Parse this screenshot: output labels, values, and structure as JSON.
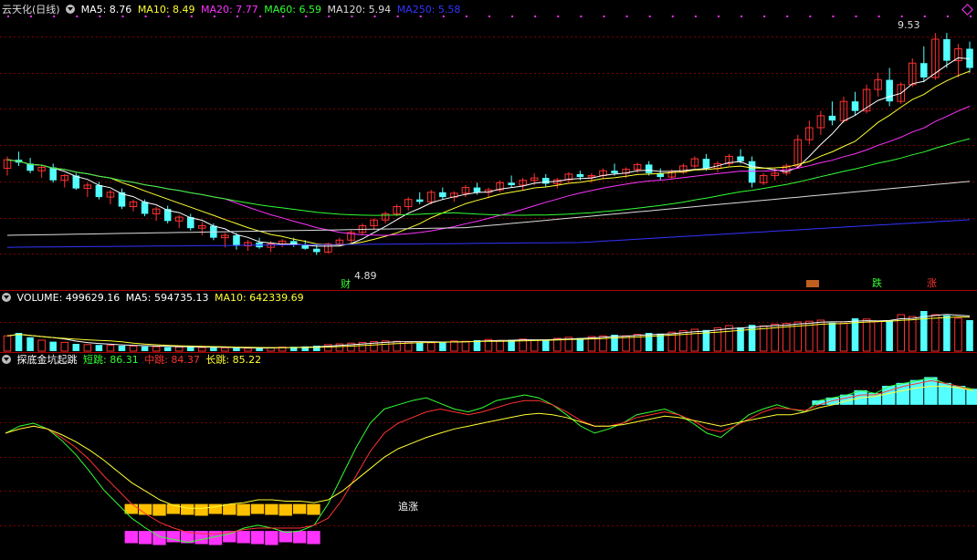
{
  "header": {
    "title": "云天化(日线)",
    "ma": [
      {
        "label": "MA5: 8.76",
        "color": "#ffffff"
      },
      {
        "label": "MA10: 8.49",
        "color": "#ffff33"
      },
      {
        "label": "MA20: 7.77",
        "color": "#ff33ff"
      },
      {
        "label": "MA60: 6.59",
        "color": "#33ff33"
      },
      {
        "label": "MA120: 5.94",
        "color": "#dddddd"
      },
      {
        "label": "MA250: 5.58",
        "color": "#3333ff"
      }
    ]
  },
  "volume_legend": {
    "title": "VOLUME: 499629.16",
    "ma5": "MA5: 594735.13",
    "ma10": "MA10: 642339.69"
  },
  "indicator_legend": {
    "title": "探底金坑起跳",
    "short": "短跳: 86.31",
    "mid": "中跳: 84.37",
    "long": "长跳: 85.22"
  },
  "annotations": {
    "high": "9.53",
    "low": "4.89",
    "cai": "财",
    "die": "跌",
    "zhang": "涨",
    "zhuizhang": "追涨"
  },
  "colors": {
    "up": "#ff3232",
    "down": "#54ffff",
    "ma5": "#ffffff",
    "ma10": "#ffff33",
    "ma20": "#ff33ff",
    "ma60": "#33ff33",
    "ma120": "#dddddd",
    "ma250": "#3333ff",
    "gold": "#ffc000",
    "pink": "#ff33ff"
  },
  "chart_data": [
    {
      "type": "candlestick",
      "title": "云天化(日线)",
      "ylim": [
        4.5,
        9.8
      ],
      "high_label": 9.53,
      "low_label": 4.89,
      "ohlc": [
        [
          6.7,
          6.95,
          6.55,
          6.88
        ],
        [
          6.88,
          7.05,
          6.75,
          6.82
        ],
        [
          6.8,
          6.92,
          6.6,
          6.65
        ],
        [
          6.65,
          6.78,
          6.5,
          6.72
        ],
        [
          6.72,
          6.8,
          6.4,
          6.45
        ],
        [
          6.45,
          6.58,
          6.3,
          6.55
        ],
        [
          6.55,
          6.6,
          6.25,
          6.28
        ],
        [
          6.28,
          6.4,
          6.1,
          6.35
        ],
        [
          6.35,
          6.42,
          6.05,
          6.1
        ],
        [
          6.1,
          6.25,
          5.95,
          6.2
        ],
        [
          6.2,
          6.28,
          5.85,
          5.9
        ],
        [
          5.9,
          6.05,
          5.8,
          6.0
        ],
        [
          6.0,
          6.05,
          5.7,
          5.75
        ],
        [
          5.75,
          5.9,
          5.6,
          5.85
        ],
        [
          5.85,
          5.92,
          5.55,
          5.6
        ],
        [
          5.6,
          5.72,
          5.45,
          5.68
        ],
        [
          5.68,
          5.75,
          5.4,
          5.45
        ],
        [
          5.45,
          5.58,
          5.3,
          5.5
        ],
        [
          5.5,
          5.55,
          5.2,
          5.25
        ],
        [
          5.25,
          5.35,
          5.05,
          5.3
        ],
        [
          5.3,
          5.35,
          5.0,
          5.08
        ],
        [
          5.08,
          5.2,
          4.98,
          5.15
        ],
        [
          5.15,
          5.25,
          5.02,
          5.05
        ],
        [
          5.05,
          5.18,
          4.95,
          5.12
        ],
        [
          5.12,
          5.22,
          5.05,
          5.18
        ],
        [
          5.18,
          5.25,
          5.06,
          5.1
        ],
        [
          5.1,
          5.2,
          5.0,
          5.02
        ],
        [
          5.02,
          5.1,
          4.89,
          4.95
        ],
        [
          4.95,
          5.15,
          4.92,
          5.12
        ],
        [
          5.12,
          5.25,
          5.08,
          5.2
        ],
        [
          5.2,
          5.4,
          5.15,
          5.36
        ],
        [
          5.36,
          5.55,
          5.3,
          5.5
        ],
        [
          5.5,
          5.65,
          5.42,
          5.62
        ],
        [
          5.62,
          5.8,
          5.55,
          5.75
        ],
        [
          5.75,
          5.95,
          5.7,
          5.9
        ],
        [
          5.9,
          6.1,
          5.82,
          6.05
        ],
        [
          6.05,
          6.2,
          5.95,
          6.0
        ],
        [
          6.0,
          6.25,
          5.95,
          6.2
        ],
        [
          6.2,
          6.3,
          6.05,
          6.1
        ],
        [
          6.1,
          6.22,
          6.0,
          6.18
        ],
        [
          6.18,
          6.35,
          6.1,
          6.3
        ],
        [
          6.3,
          6.4,
          6.15,
          6.2
        ],
        [
          6.2,
          6.3,
          6.08,
          6.25
        ],
        [
          6.25,
          6.45,
          6.2,
          6.4
        ],
        [
          6.4,
          6.55,
          6.3,
          6.35
        ],
        [
          6.35,
          6.5,
          6.25,
          6.45
        ],
        [
          6.45,
          6.6,
          6.35,
          6.5
        ],
        [
          6.5,
          6.58,
          6.3,
          6.38
        ],
        [
          6.38,
          6.5,
          6.28,
          6.46
        ],
        [
          6.46,
          6.62,
          6.4,
          6.58
        ],
        [
          6.58,
          6.65,
          6.45,
          6.52
        ],
        [
          6.52,
          6.6,
          6.4,
          6.55
        ],
        [
          6.55,
          6.7,
          6.48,
          6.65
        ],
        [
          6.65,
          6.8,
          6.55,
          6.6
        ],
        [
          6.6,
          6.72,
          6.5,
          6.68
        ],
        [
          6.68,
          6.82,
          6.6,
          6.78
        ],
        [
          6.78,
          6.85,
          6.55,
          6.6
        ],
        [
          6.6,
          6.7,
          6.45,
          6.52
        ],
        [
          6.52,
          6.68,
          6.48,
          6.62
        ],
        [
          6.62,
          6.8,
          6.58,
          6.75
        ],
        [
          6.75,
          6.95,
          6.7,
          6.9
        ],
        [
          6.9,
          7.0,
          6.65,
          6.7
        ],
        [
          6.7,
          6.85,
          6.62,
          6.8
        ],
        [
          6.8,
          7.0,
          6.75,
          6.95
        ],
        [
          6.95,
          7.1,
          6.8,
          6.85
        ],
        [
          6.85,
          6.95,
          6.3,
          6.4
        ],
        [
          6.4,
          6.6,
          6.35,
          6.55
        ],
        [
          6.55,
          6.7,
          6.45,
          6.6
        ],
        [
          6.6,
          6.8,
          6.55,
          6.75
        ],
        [
          6.75,
          7.4,
          6.7,
          7.3
        ],
        [
          7.3,
          7.7,
          7.2,
          7.55
        ],
        [
          7.55,
          7.9,
          7.4,
          7.8
        ],
        [
          7.8,
          8.1,
          7.6,
          7.7
        ],
        [
          7.7,
          8.2,
          7.65,
          8.1
        ],
        [
          8.1,
          8.3,
          7.8,
          7.9
        ],
        [
          7.9,
          8.45,
          7.85,
          8.35
        ],
        [
          8.35,
          8.7,
          8.2,
          8.55
        ],
        [
          8.55,
          8.8,
          8.0,
          8.1
        ],
        [
          8.1,
          8.5,
          8.05,
          8.45
        ],
        [
          8.45,
          9.0,
          8.4,
          8.9
        ],
        [
          8.9,
          9.25,
          8.5,
          8.6
        ],
        [
          8.6,
          9.53,
          8.55,
          9.4
        ],
        [
          9.4,
          9.53,
          8.8,
          8.95
        ],
        [
          8.95,
          9.3,
          8.6,
          9.2
        ],
        [
          9.2,
          9.35,
          8.7,
          8.8
        ]
      ]
    },
    {
      "type": "bar",
      "title": "VOLUME",
      "series": [
        {
          "name": "VOLUME"
        },
        {
          "name": "MA5"
        },
        {
          "name": "MA10"
        }
      ],
      "values": [
        420,
        500,
        380,
        300,
        260,
        240,
        200,
        180,
        170,
        160,
        150,
        140,
        130,
        120,
        110,
        115,
        120,
        100,
        95,
        90,
        85,
        80,
        90,
        95,
        110,
        120,
        130,
        150,
        180,
        200,
        220,
        240,
        260,
        280,
        270,
        250,
        240,
        230,
        260,
        280,
        270,
        300,
        320,
        290,
        310,
        330,
        300,
        320,
        350,
        380,
        360,
        400,
        420,
        450,
        420,
        460,
        500,
        480,
        520,
        560,
        600,
        580,
        640,
        700,
        650,
        720,
        690,
        740,
        760,
        800,
        820,
        850,
        780,
        760,
        900,
        880,
        820,
        840,
        1000,
        950,
        1100,
        1000,
        980,
        900,
        850
      ],
      "ylim": [
        0,
        1200
      ]
    },
    {
      "type": "line",
      "title": "探底金坑起跳",
      "series": [
        {
          "name": "短跳",
          "color": "#33ff33",
          "values": [
            55,
            60,
            62,
            58,
            50,
            40,
            28,
            15,
            5,
            -5,
            -12,
            -18,
            -20,
            -22,
            -20,
            -18,
            -16,
            -12,
            -10,
            -12,
            -15,
            -14,
            -10,
            5,
            25,
            45,
            62,
            72,
            75,
            78,
            80,
            76,
            72,
            70,
            73,
            78,
            80,
            82,
            80,
            75,
            68,
            60,
            55,
            58,
            62,
            68,
            70,
            72,
            68,
            62,
            55,
            52,
            60,
            68,
            72,
            75,
            72,
            70,
            78,
            80,
            82,
            85,
            83,
            88,
            90,
            92,
            94,
            90,
            88,
            86
          ]
        },
        {
          "name": "中跳",
          "color": "#ff3232",
          "values": [
            55,
            58,
            60,
            58,
            52,
            45,
            36,
            25,
            15,
            5,
            -2,
            -8,
            -12,
            -15,
            -16,
            -16,
            -15,
            -13,
            -12,
            -12,
            -12,
            -12,
            -10,
            -5,
            8,
            25,
            42,
            55,
            62,
            66,
            70,
            72,
            70,
            68,
            70,
            73,
            76,
            78,
            78,
            75,
            70,
            64,
            60,
            60,
            62,
            66,
            68,
            70,
            68,
            64,
            58,
            56,
            60,
            65,
            70,
            73,
            72,
            71,
            75,
            78,
            80,
            82,
            82,
            85,
            88,
            90,
            92,
            90,
            88,
            85
          ]
        },
        {
          "name": "长跳",
          "color": "#ffff33",
          "values": [
            55,
            58,
            60,
            58,
            54,
            49,
            43,
            36,
            28,
            20,
            14,
            8,
            4,
            2,
            2,
            3,
            5,
            6,
            8,
            8,
            7,
            7,
            6,
            8,
            14,
            22,
            30,
            38,
            44,
            48,
            52,
            55,
            58,
            60,
            62,
            64,
            66,
            68,
            69,
            68,
            66,
            63,
            60,
            60,
            61,
            63,
            65,
            67,
            66,
            64,
            62,
            60,
            62,
            64,
            66,
            68,
            68,
            70,
            73,
            75,
            78,
            80,
            81,
            83,
            85,
            87,
            88,
            88,
            87,
            85
          ]
        }
      ],
      "ylim": [
        -30,
        100
      ]
    }
  ]
}
